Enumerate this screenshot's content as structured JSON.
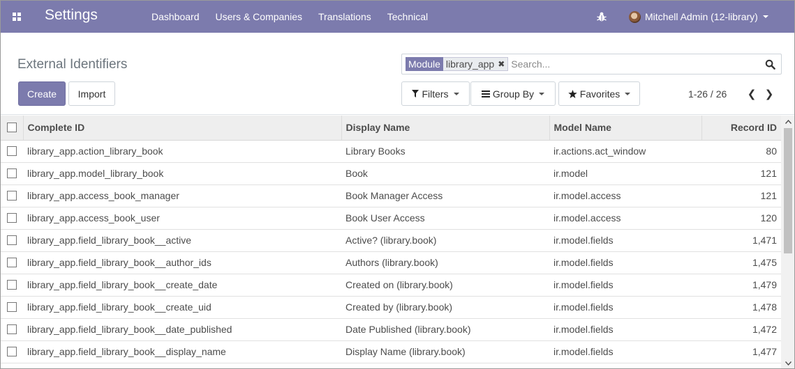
{
  "navbar": {
    "app_title": "Settings",
    "menu": [
      "Dashboard",
      "Users & Companies",
      "Translations",
      "Technical"
    ],
    "user_label": "Mitchell Admin (12-library)",
    "bar_color": "#7c7bad"
  },
  "control_panel": {
    "title": "External Identifiers",
    "create_label": "Create",
    "import_label": "Import",
    "search": {
      "facet_label": "Module",
      "facet_value": "library_app",
      "facet_remove": "✖",
      "placeholder": "Search..."
    },
    "filters_label": "Filters",
    "groupby_label": "Group By",
    "favorites_label": "Favorites",
    "pager": {
      "range": "1-26 / 26",
      "prev": "❮",
      "next": "❯"
    }
  },
  "table": {
    "columns": [
      "Complete ID",
      "Display Name",
      "Model Name",
      "Record ID"
    ],
    "rows": [
      {
        "complete_id": "library_app.action_library_book",
        "display_name": "Library Books",
        "model": "ir.actions.act_window",
        "record_id": "80"
      },
      {
        "complete_id": "library_app.model_library_book",
        "display_name": "Book",
        "model": "ir.model",
        "record_id": "121"
      },
      {
        "complete_id": "library_app.access_book_manager",
        "display_name": "Book Manager Access",
        "model": "ir.model.access",
        "record_id": "121"
      },
      {
        "complete_id": "library_app.access_book_user",
        "display_name": "Book User Access",
        "model": "ir.model.access",
        "record_id": "120"
      },
      {
        "complete_id": "library_app.field_library_book__active",
        "display_name": "Active? (library.book)",
        "model": "ir.model.fields",
        "record_id": "1,471"
      },
      {
        "complete_id": "library_app.field_library_book__author_ids",
        "display_name": "Authors (library.book)",
        "model": "ir.model.fields",
        "record_id": "1,475"
      },
      {
        "complete_id": "library_app.field_library_book__create_date",
        "display_name": "Created on (library.book)",
        "model": "ir.model.fields",
        "record_id": "1,479"
      },
      {
        "complete_id": "library_app.field_library_book__create_uid",
        "display_name": "Created by (library.book)",
        "model": "ir.model.fields",
        "record_id": "1,478"
      },
      {
        "complete_id": "library_app.field_library_book__date_published",
        "display_name": "Date Published (library.book)",
        "model": "ir.model.fields",
        "record_id": "1,472"
      },
      {
        "complete_id": "library_app.field_library_book__display_name",
        "display_name": "Display Name (library.book)",
        "model": "ir.model.fields",
        "record_id": "1,477"
      }
    ]
  }
}
